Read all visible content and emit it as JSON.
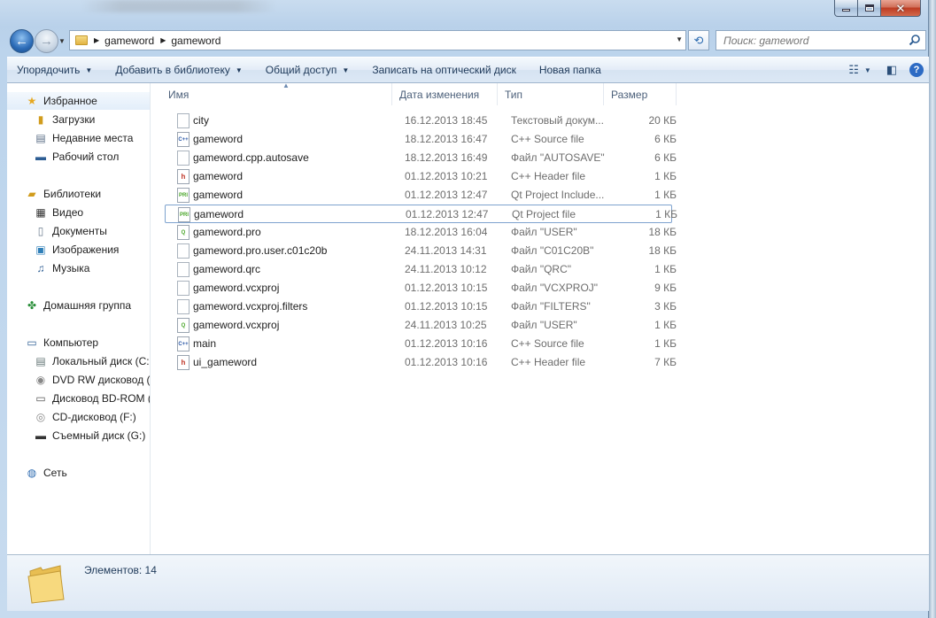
{
  "window": {
    "path": [
      "gameword",
      "gameword"
    ]
  },
  "search": {
    "placeholder": "Поиск: gameword"
  },
  "toolbar": {
    "items": [
      {
        "label": "Упорядочить",
        "has_dropdown": true
      },
      {
        "label": "Добавить в библиотеку",
        "has_dropdown": true
      },
      {
        "label": "Общий доступ",
        "has_dropdown": true
      },
      {
        "label": "Записать на оптический диск",
        "has_dropdown": false
      },
      {
        "label": "Новая папка",
        "has_dropdown": false
      }
    ]
  },
  "sidebar": {
    "favorites": "Избранное",
    "downloads": "Загрузки",
    "recent": "Недавние места",
    "desktop": "Рабочий стол",
    "libraries": "Библиотеки",
    "video": "Видео",
    "documents": "Документы",
    "images": "Изображения",
    "music": "Музыка",
    "homegroup": "Домашняя группа",
    "computer": "Компьютер",
    "local_disk": "Локальный диск (C:",
    "dvd": "DVD RW дисковод (",
    "bd": "Дисковод BD-ROM (",
    "cd": "CD-дисковод (F:)",
    "removable": "Съемный диск (G:)",
    "network": "Сеть"
  },
  "columns": {
    "name": "Имя",
    "date": "Дата изменения",
    "type": "Тип",
    "size": "Размер"
  },
  "files": [
    {
      "name": "city",
      "date": "16.12.2013 18:45",
      "type": "Текстовый докум...",
      "size": "20 КБ",
      "icon": "text-file-icon"
    },
    {
      "name": "gameword",
      "date": "18.12.2013 16:47",
      "type": "C++ Source file",
      "size": "6 КБ",
      "icon": "cpp-file-icon"
    },
    {
      "name": "gameword.cpp.autosave",
      "date": "18.12.2013 16:49",
      "type": "Файл \"AUTOSAVE\"",
      "size": "6 КБ",
      "icon": "file-icon"
    },
    {
      "name": "gameword",
      "date": "01.12.2013 10:21",
      "type": "C++ Header file",
      "size": "1 КБ",
      "icon": "header-file-icon"
    },
    {
      "name": "gameword",
      "date": "01.12.2013 12:47",
      "type": "Qt Project Include...",
      "size": "1 КБ",
      "icon": "qt-project-icon"
    },
    {
      "name": "gameword",
      "date": "01.12.2013 12:47",
      "type": "Qt Project file",
      "size": "1 КБ",
      "icon": "qt-project-icon"
    },
    {
      "name": "gameword.pro",
      "date": "18.12.2013 16:04",
      "type": "Файл \"USER\"",
      "size": "18 КБ",
      "icon": "qt-creator-icon"
    },
    {
      "name": "gameword.pro.user.c01c20b",
      "date": "24.11.2013 14:31",
      "type": "Файл \"C01C20B\"",
      "size": "18 КБ",
      "icon": "file-icon"
    },
    {
      "name": "gameword.qrc",
      "date": "24.11.2013 10:12",
      "type": "Файл \"QRC\"",
      "size": "1 КБ",
      "icon": "file-icon"
    },
    {
      "name": "gameword.vcxproj",
      "date": "01.12.2013 10:15",
      "type": "Файл \"VCXPROJ\"",
      "size": "9 КБ",
      "icon": "file-icon"
    },
    {
      "name": "gameword.vcxproj.filters",
      "date": "01.12.2013 10:15",
      "type": "Файл \"FILTERS\"",
      "size": "3 КБ",
      "icon": "file-icon"
    },
    {
      "name": "gameword.vcxproj",
      "date": "24.11.2013 10:25",
      "type": "Файл \"USER\"",
      "size": "1 КБ",
      "icon": "qt-creator-icon"
    },
    {
      "name": "main",
      "date": "01.12.2013 10:16",
      "type": "C++ Source file",
      "size": "1 КБ",
      "icon": "cpp-file-icon"
    },
    {
      "name": "ui_gameword",
      "date": "01.12.2013 10:16",
      "type": "C++ Header file",
      "size": "7 КБ",
      "icon": "header-file-icon"
    }
  ],
  "status": {
    "text": "Элементов: 14"
  }
}
